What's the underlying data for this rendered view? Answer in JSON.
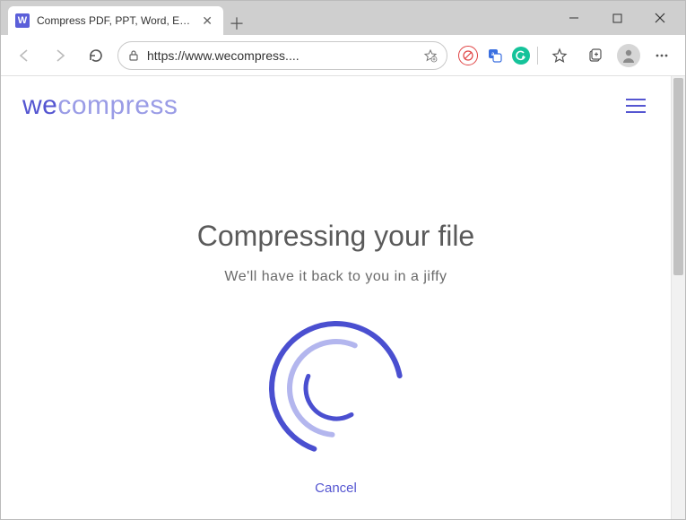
{
  "window": {
    "tab": {
      "favicon_letter": "W",
      "title": "Compress PDF, PPT, Word, Excel"
    }
  },
  "toolbar": {
    "url": "https://www.wecompress....",
    "extensions": {
      "ext1_title": "Extension",
      "ext2_title": "Extension",
      "ext3_title": "Grammarly"
    }
  },
  "page": {
    "logo_we": "we",
    "logo_compress": "compress",
    "heading": "Compressing your file",
    "subheading": "We'll have it back to you in a jiffy",
    "cancel": "Cancel"
  },
  "colors": {
    "brand_primary": "#5556d1",
    "brand_light": "#9a9ce6"
  }
}
